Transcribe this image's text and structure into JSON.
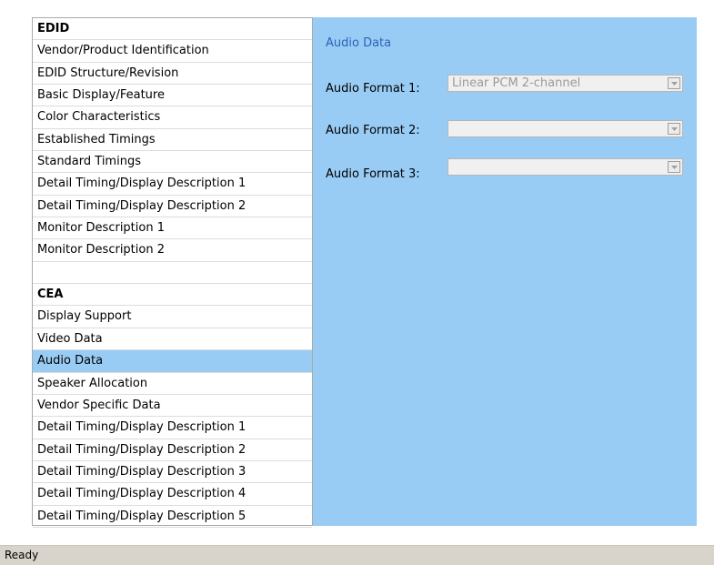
{
  "nav": {
    "items": [
      {
        "label": "EDID",
        "kind": "header"
      },
      {
        "label": "Vendor/Product Identification",
        "kind": "item"
      },
      {
        "label": "EDID Structure/Revision",
        "kind": "item"
      },
      {
        "label": "Basic Display/Feature",
        "kind": "item"
      },
      {
        "label": "Color Characteristics",
        "kind": "item"
      },
      {
        "label": "Established Timings",
        "kind": "item"
      },
      {
        "label": "Standard Timings",
        "kind": "item"
      },
      {
        "label": "Detail Timing/Display Description 1",
        "kind": "item"
      },
      {
        "label": "Detail Timing/Display Description 2",
        "kind": "item"
      },
      {
        "label": "Monitor Description 1",
        "kind": "item"
      },
      {
        "label": "Monitor Description 2",
        "kind": "item"
      },
      {
        "label": "",
        "kind": "blank"
      },
      {
        "label": "CEA",
        "kind": "header"
      },
      {
        "label": "Display Support",
        "kind": "item"
      },
      {
        "label": "Video Data",
        "kind": "item"
      },
      {
        "label": "Audio Data",
        "kind": "item",
        "selected": true
      },
      {
        "label": "Speaker Allocation",
        "kind": "item"
      },
      {
        "label": "Vendor Specific Data",
        "kind": "item"
      },
      {
        "label": "Detail Timing/Display Description 1",
        "kind": "item"
      },
      {
        "label": "Detail Timing/Display Description 2",
        "kind": "item"
      },
      {
        "label": "Detail Timing/Display Description 3",
        "kind": "item"
      },
      {
        "label": "Detail Timing/Display Description 4",
        "kind": "item"
      },
      {
        "label": "Detail Timing/Display Description 5",
        "kind": "item"
      }
    ]
  },
  "detail": {
    "title": "Audio Data",
    "fields": [
      {
        "label": "Audio Format 1:",
        "value": "Linear PCM 2-channel",
        "disabled": true
      },
      {
        "label": "Audio Format 2:",
        "value": "",
        "disabled": true
      },
      {
        "label": "Audio Format 3:",
        "value": "",
        "disabled": true
      }
    ]
  },
  "status": {
    "text": "Ready"
  },
  "colors": {
    "selection": "#99ccf5",
    "panel": "#99ccf5",
    "title": "#2a62b8",
    "statusbar": "#d8d4cc"
  }
}
